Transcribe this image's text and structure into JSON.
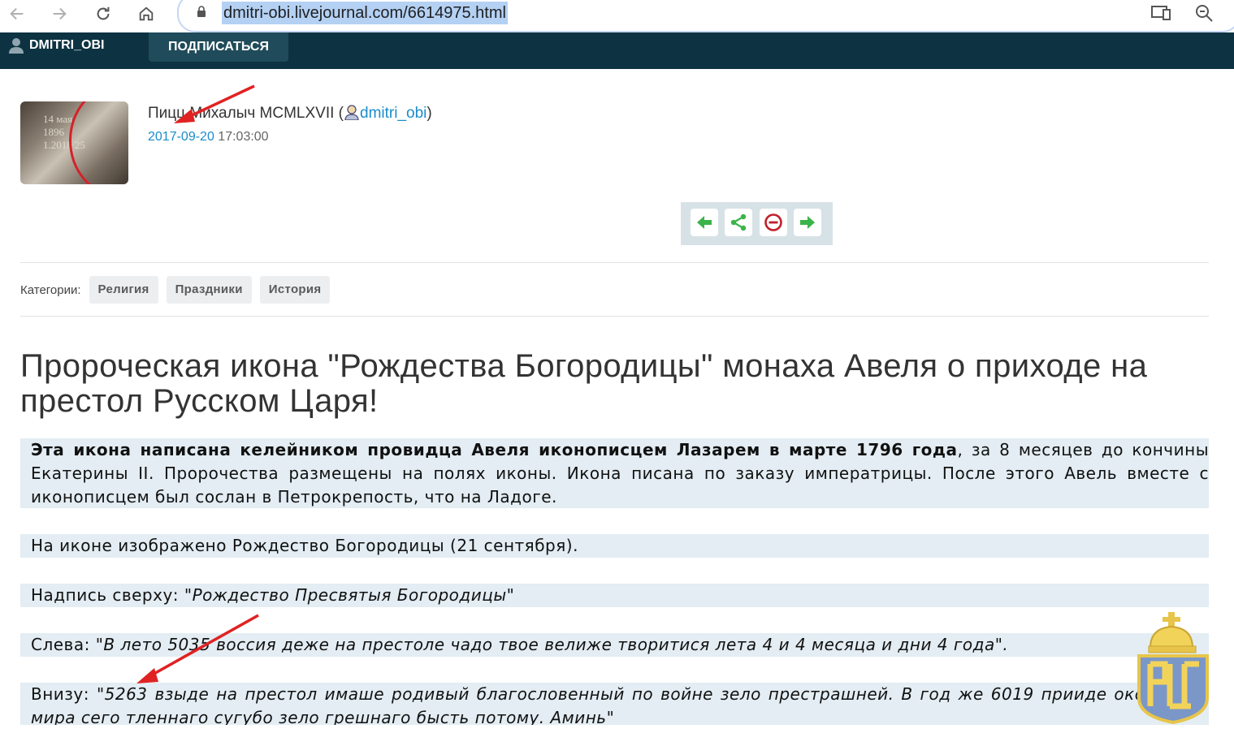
{
  "browser": {
    "url": "dmitri-obi.livejournal.com/6614975.html",
    "icons": [
      "back-icon",
      "forward-icon",
      "reload-icon",
      "home-icon",
      "lock-icon",
      "cast-icon",
      "zoom-icon"
    ]
  },
  "ljbar": {
    "username": "DMITRI_OBI",
    "subscribe": "ПОДПИСАТЬСЯ"
  },
  "post": {
    "author_prefix": "Пицц",
    "author_rest": "Михалыч MCMLXVII (",
    "username": "dmitri_obi",
    "author_suffix": ")",
    "date": "2017-09-20",
    "time": "17:03:00",
    "avatar_text": [
      "14 мая",
      "1896",
      "1.2018 25"
    ],
    "categories_label": "Категории:",
    "categories": [
      "Религия",
      "Праздники",
      "История"
    ],
    "title": "Пророческая икона \"Рождества Богородицы\" монаха Авеля о приходе на престол Русском Царя!",
    "p1_bold": "Эта икона написана келейником провидца Авеля иконописцем Лазарем в марте 1796 года",
    "p1_rest": ", за 8 месяцев до кончины Екатерины II. Пророчества размещены на полях иконы. Икона писана по заказу императрицы. После этого Авель вместе с иконописцем был сослан в Петрокрепость, что на Ладоге.",
    "p2": "На иконе изображено Рождество Богородицы (21 сентября).",
    "p3_label": "Надпись сверху: ",
    "p3_quote": "\"Рождество Пресвятыя Богородицы\"",
    "p4_label": "Слева: ",
    "p4_quote": "\"В лето 5035 воссия деже на престоле чадо твое велиже творитися лета 4 и 4 месяца и дни 4 года\".",
    "p5_label": "Внизу: ",
    "p5_quote": "\"5263 взыде на престол имаше родивый благословенный по войне зело престрашней. В год же 6019 прииде окончание мира сего тленнаго сугубо зело грешнаго бысть потому. Аминь\""
  },
  "colors": {
    "ljbar": "#0d3342",
    "link": "#1a8ccb",
    "quote_bg": "#e3edf3",
    "annotation_arrow": "#e02222"
  }
}
